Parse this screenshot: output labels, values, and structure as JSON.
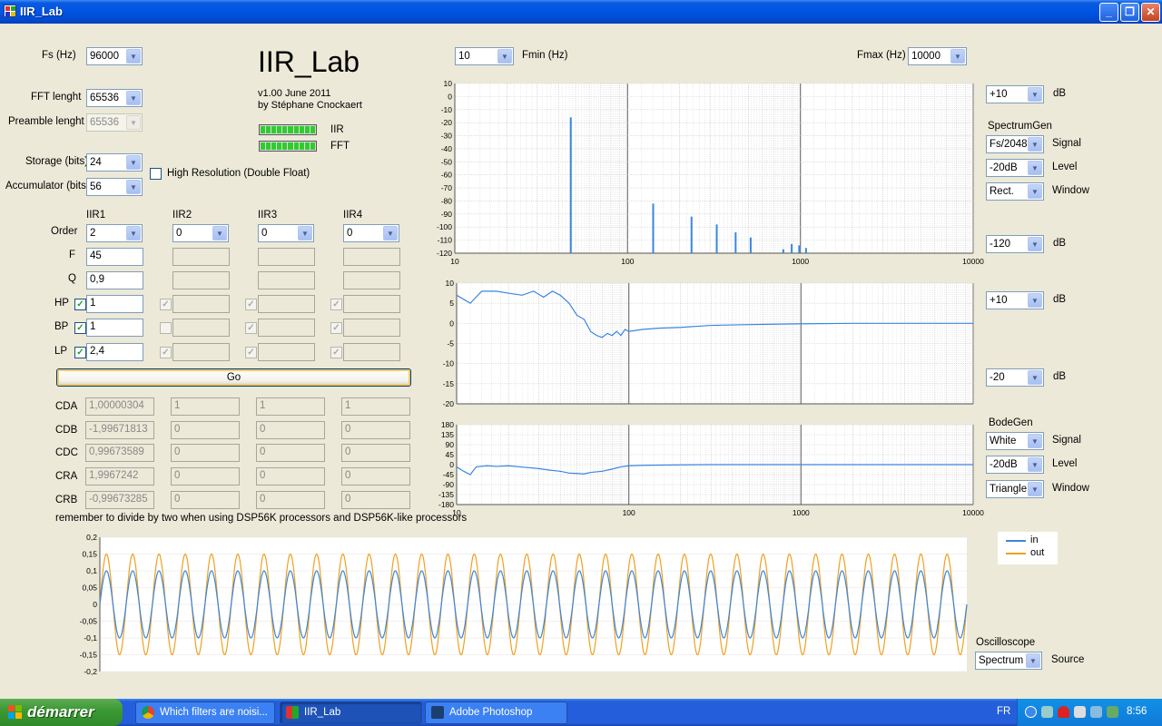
{
  "window": {
    "title": "IIR_Lab",
    "min": "_",
    "max": "❐",
    "close": "✕"
  },
  "app": {
    "title": "IIR_Lab",
    "version": "v1.00 June 2011",
    "author": "by Stéphane Cnockaert",
    "led_iir": "IIR",
    "led_fft": "FFT"
  },
  "settings": {
    "fs": {
      "label": "Fs (Hz)",
      "value": "96000"
    },
    "fft": {
      "label": "FFT lenght",
      "value": "65536"
    },
    "preamble": {
      "label": "Preamble lenght",
      "value": "65536"
    },
    "storage": {
      "label": "Storage (bits)",
      "value": "24"
    },
    "accumulator": {
      "label": "Accumulator (bits)",
      "value": "56"
    },
    "high_res_label": "High Resolution (Double Float)"
  },
  "iir": {
    "headers": [
      "IIR1",
      "IIR2",
      "IIR3",
      "IIR4"
    ],
    "row_labels": {
      "order": "Order",
      "f": "F",
      "q": "Q",
      "hp": "HP",
      "bp": "BP",
      "lp": "LP"
    },
    "order": [
      "2",
      "0",
      "0",
      "0"
    ],
    "f": [
      "45",
      "",
      "",
      ""
    ],
    "q": [
      "0,9",
      "",
      "",
      ""
    ],
    "hp": [
      "1",
      "",
      "",
      ""
    ],
    "bp": [
      "1",
      "",
      "",
      ""
    ],
    "lp": [
      "2,4",
      "",
      "",
      ""
    ],
    "check_mark": "✓"
  },
  "go_label": "Go",
  "coeffs": {
    "labels": [
      "CDA",
      "CDB",
      "CDC",
      "CRA",
      "CRB"
    ],
    "rows": [
      [
        "1,00000304",
        "1",
        "1",
        "1"
      ],
      [
        "-1,99671813",
        "0",
        "0",
        "0"
      ],
      [
        "0,99673589",
        "0",
        "0",
        "0"
      ],
      [
        "1,9967242",
        "0",
        "0",
        "0"
      ],
      [
        "-0,99673285",
        "0",
        "0",
        "0"
      ]
    ]
  },
  "note": "remember to divide by two when using DSP56K processors and DSP56K-like processors",
  "freq": {
    "fmin_label": "Fmin (Hz)",
    "fmin_value": "10",
    "fmax_label": "Fmax (Hz)",
    "fmax_value": "10000"
  },
  "spectrum_ctrl": {
    "top": "+10",
    "top_unit": "dB",
    "gen_label": "SpectrumGen",
    "signal": "Fs/2048",
    "signal_label": "Signal",
    "level": "-20dB",
    "level_label": "Level",
    "window": "Rect.",
    "window_label": "Window",
    "bottom": "-120",
    "bottom_unit": "dB"
  },
  "mag_ctrl": {
    "top": "+10",
    "top_unit": "dB",
    "bottom": "-20",
    "bottom_unit": "dB"
  },
  "bode_ctrl": {
    "gen_label": "BodeGen",
    "signal": "White",
    "signal_label": "Signal",
    "level": "-20dB",
    "level_label": "Level",
    "window": "Triangle",
    "window_label": "Window"
  },
  "scope_ctrl": {
    "label": "Oscilloscope",
    "source": "Spectrum",
    "source_label": "Source"
  },
  "chart_data": [
    {
      "type": "bar",
      "name": "spectrum",
      "x_scale": "log",
      "xlim": [
        10,
        10000
      ],
      "ylim": [
        -120,
        10
      ],
      "x_ticks": [
        "10",
        "100",
        "1000",
        "10000"
      ],
      "y_ticks": [
        "10",
        "0",
        "-10",
        "-20",
        "-30",
        "-40",
        "-50",
        "-60",
        "-70",
        "-80",
        "-90",
        "-100",
        "-110",
        "-120"
      ],
      "x": [
        46.9,
        140.6,
        234.4,
        328.1,
        421.9,
        515.6,
        796.9,
        890.6,
        984.4,
        1078.1
      ],
      "values": [
        -16,
        -82,
        -92,
        -98,
        -104,
        -108,
        -117,
        -113,
        -114,
        -116
      ],
      "color": "#3a86e0"
    },
    {
      "type": "line",
      "name": "magnitude",
      "x_scale": "log",
      "xlim": [
        10,
        10000
      ],
      "ylim": [
        -20,
        10
      ],
      "x_ticks": [
        "10",
        "100",
        "1000",
        "10000"
      ],
      "y_ticks": [
        "10",
        "5",
        "0",
        "-5",
        "-10",
        "-15",
        "-20"
      ],
      "x": [
        10,
        12,
        14,
        17,
        20,
        24,
        28,
        32,
        36,
        40,
        45,
        50,
        55,
        60,
        65,
        70,
        75,
        80,
        85,
        90,
        95,
        100,
        120,
        150,
        200,
        300,
        500,
        1000,
        2000,
        5000,
        10000
      ],
      "y": [
        7,
        5,
        8,
        8,
        7.5,
        7,
        8,
        6.5,
        8,
        7,
        5,
        2,
        1,
        -2,
        -3,
        -3.5,
        -2.5,
        -3,
        -2,
        -3,
        -1.5,
        -2,
        -1.5,
        -1.2,
        -1,
        -0.5,
        -0.3,
        -0.1,
        0,
        0,
        0
      ],
      "color": "#3a86e0"
    },
    {
      "type": "line",
      "name": "phase",
      "x_scale": "log",
      "xlim": [
        10,
        10000
      ],
      "ylim": [
        -180,
        180
      ],
      "x_ticks": [
        "10",
        "100",
        "1000",
        "10000"
      ],
      "y_ticks": [
        "180",
        "135",
        "90",
        "45",
        "0",
        "-45",
        "-90",
        "-135",
        "-180"
      ],
      "x": [
        10,
        11,
        12,
        13,
        15,
        17,
        20,
        25,
        30,
        35,
        40,
        45,
        50,
        55,
        60,
        70,
        80,
        90,
        100,
        120,
        150,
        200,
        300,
        500,
        1000,
        2000,
        5000,
        10000
      ],
      "y": [
        -10,
        -30,
        -45,
        -10,
        -5,
        -8,
        -5,
        -12,
        -18,
        -25,
        -30,
        -38,
        -40,
        -42,
        -35,
        -30,
        -20,
        -10,
        -5,
        -3,
        -2,
        -1,
        0,
        0,
        0,
        0,
        0,
        0
      ],
      "color": "#3a86e0"
    },
    {
      "type": "line",
      "name": "oscilloscope",
      "xlim": [
        0,
        66
      ],
      "ylim": [
        -0.2,
        0.2
      ],
      "y_ticks": [
        "0,2",
        "0,15",
        "0,1",
        "0,05",
        "0",
        "-0,05",
        "-0,1",
        "-0,15",
        "-0,2"
      ],
      "cycles": 33,
      "series": [
        {
          "name": "in",
          "amplitude": 0.1,
          "color": "#3a86e0"
        },
        {
          "name": "out",
          "amplitude": 0.15,
          "color": "#f0a020"
        }
      ]
    }
  ],
  "taskbar": {
    "start": "démarrer",
    "tasks": [
      "Which filters are noisi...",
      "IIR_Lab",
      "Adobe Photoshop"
    ],
    "lang": "FR",
    "clock": "8:56"
  }
}
